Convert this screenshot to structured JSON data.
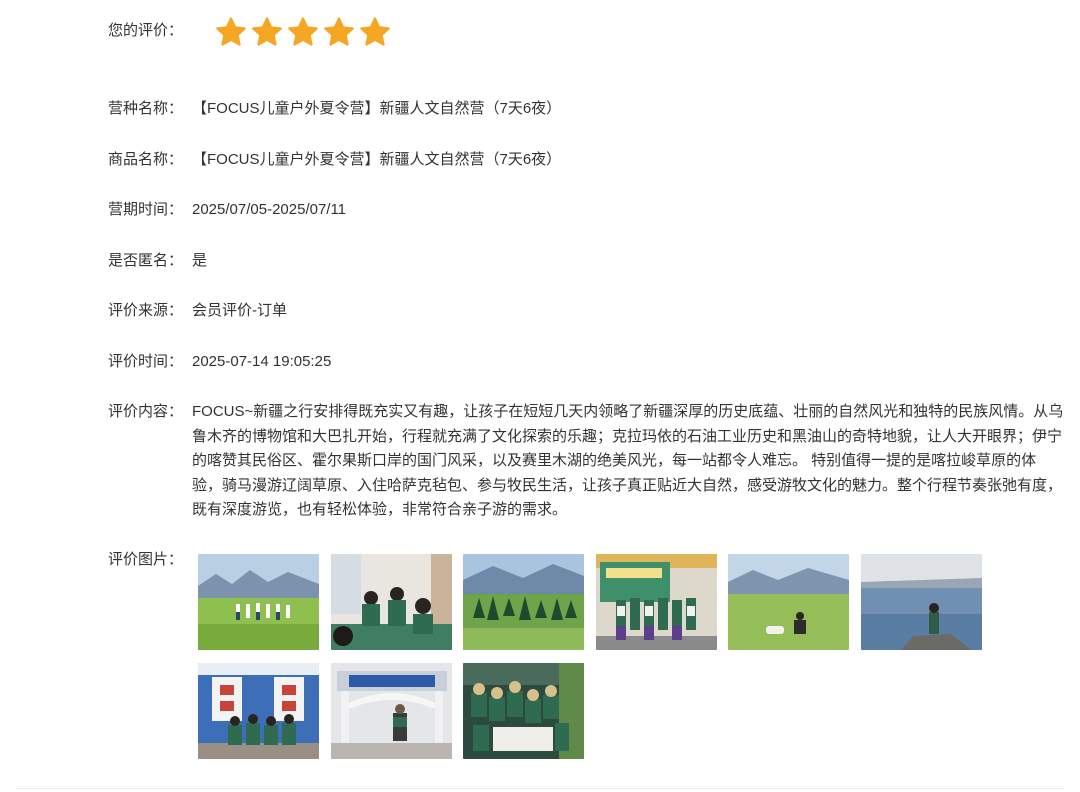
{
  "rating": {
    "label": "您的评价：",
    "stars": 5,
    "max_stars": 5,
    "star_color": "#F5A623"
  },
  "fields": {
    "camp_type": {
      "label": "营种名称：",
      "value": "【FOCUS儿童户外夏令营】新疆人文自然营（7天6夜）"
    },
    "product_name": {
      "label": "商品名称：",
      "value": "【FOCUS儿童户外夏令营】新疆人文自然营（7天6夜）"
    },
    "camp_period": {
      "label": "营期时间：",
      "value": "2025/07/05-2025/07/11"
    },
    "anonymous": {
      "label": "是否匿名：",
      "value": "是"
    },
    "source": {
      "label": "评价来源：",
      "value": "会员评价-订单"
    },
    "review_time": {
      "label": "评价时间：",
      "value": "2025-07-14 19:05:25"
    },
    "content": {
      "label": "评价内容：",
      "value": "FOCUS~新疆之行安排得既充实又有趣，让孩子在短短几天内领略了新疆深厚的历史底蕴、壮丽的自然风光和独特的民族风情。从乌鲁木齐的博物馆和大巴扎开始，行程就充满了文化探索的乐趣；克拉玛依的石油工业历史和黑油山的奇特地貌，让人大开眼界；伊宁的喀赞其民俗区、霍尔果斯口岸的国门风采，以及赛里木湖的绝美风光，每一站都令人难忘。 特别值得一提的是喀拉峻草原的体验，骑马漫游辽阔草原、入住哈萨克毡包、参与牧民生活，让孩子真正贴近大自然，感受游牧文化的魅力。整个行程节奏张弛有度，既有深度游览，也有轻松体验，非常符合亲子游的需求。"
    },
    "images": {
      "label": "评价图片："
    }
  }
}
